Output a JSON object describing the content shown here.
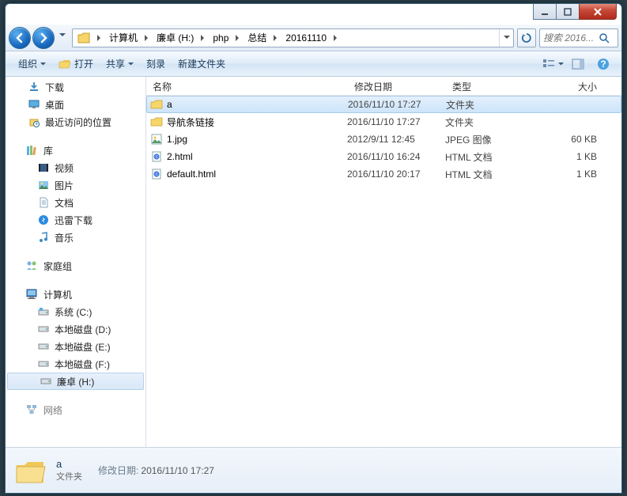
{
  "titlebar": {
    "min": "—",
    "max": "▢",
    "close": "✕"
  },
  "breadcrumbs": [
    "计算机",
    "廉卓 (H:)",
    "php",
    "总结",
    "20161110"
  ],
  "search": {
    "placeholder": "搜索 2016..."
  },
  "toolbar": {
    "organize": "组织",
    "open": "打开",
    "share": "共享",
    "burn": "刻录",
    "newfolder": "新建文件夹"
  },
  "sidebar": {
    "favorites": [
      {
        "label": "下载",
        "icon": "download"
      },
      {
        "label": "桌面",
        "icon": "desktop"
      },
      {
        "label": "最近访问的位置",
        "icon": "recent"
      }
    ],
    "libraries_label": "库",
    "libraries": [
      {
        "label": "视频",
        "icon": "video"
      },
      {
        "label": "图片",
        "icon": "picture"
      },
      {
        "label": "文档",
        "icon": "doc"
      },
      {
        "label": "迅雷下载",
        "icon": "xunlei"
      },
      {
        "label": "音乐",
        "icon": "music"
      }
    ],
    "homegroup_label": "家庭组",
    "computer_label": "计算机",
    "drives": [
      {
        "label": "系统 (C:)",
        "icon": "drive-sys"
      },
      {
        "label": "本地磁盘 (D:)",
        "icon": "drive"
      },
      {
        "label": "本地磁盘 (E:)",
        "icon": "drive"
      },
      {
        "label": "本地磁盘 (F:)",
        "icon": "drive"
      },
      {
        "label": "廉卓 (H:)",
        "icon": "drive",
        "selected": true
      }
    ],
    "network_label": "网络"
  },
  "columns": {
    "name": "名称",
    "date": "修改日期",
    "type": "类型",
    "size": "大小"
  },
  "files": [
    {
      "name": "a",
      "date": "2016/11/10 17:27",
      "type": "文件夹",
      "size": "",
      "icon": "folder",
      "selected": true
    },
    {
      "name": "导航条链接",
      "date": "2016/11/10 17:27",
      "type": "文件夹",
      "size": "",
      "icon": "folder"
    },
    {
      "name": "1.jpg",
      "date": "2012/9/11 12:45",
      "type": "JPEG 图像",
      "size": "60 KB",
      "icon": "image"
    },
    {
      "name": "2.html",
      "date": "2016/11/10 16:24",
      "type": "HTML 文档",
      "size": "1 KB",
      "icon": "html"
    },
    {
      "name": "default.html",
      "date": "2016/11/10 20:17",
      "type": "HTML 文档",
      "size": "1 KB",
      "icon": "html"
    }
  ],
  "details": {
    "name": "a",
    "sub": "文件夹",
    "mod_label": "修改日期:",
    "mod_value": "2016/11/10 17:27"
  }
}
